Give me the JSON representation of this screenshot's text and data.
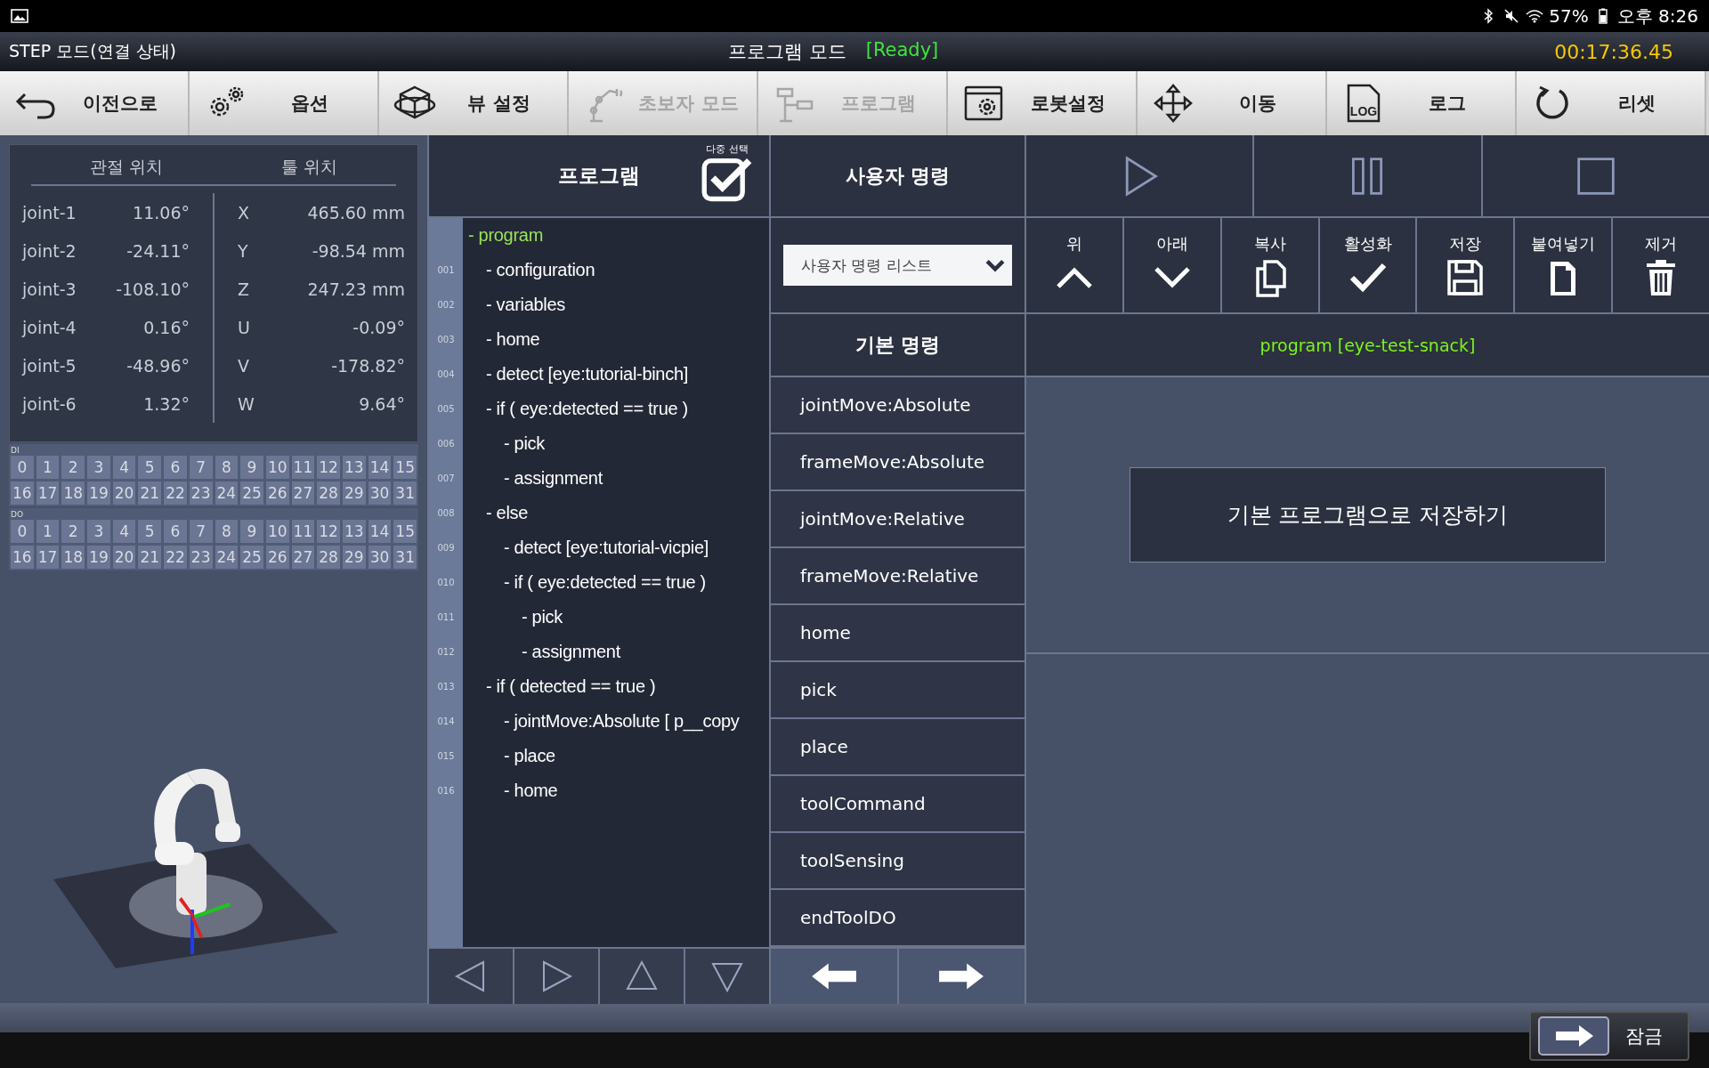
{
  "status_bar": {
    "battery": "57%",
    "time": "오후 8:26"
  },
  "title_bar": {
    "mode": "STEP 모드(연결 상태)",
    "title": "프로그램 모드",
    "state": "[Ready]",
    "timer": "00:17:36.45"
  },
  "toolbar": [
    {
      "label": "이전으로",
      "disabled": false
    },
    {
      "label": "옵션",
      "disabled": false
    },
    {
      "label": "뷰 설정",
      "disabled": false
    },
    {
      "label": "초보자 모드",
      "disabled": true
    },
    {
      "label": "프로그램",
      "disabled": true
    },
    {
      "label": "로봇설정",
      "disabled": false
    },
    {
      "label": "이동",
      "disabled": false
    },
    {
      "label": "로그",
      "disabled": false,
      "icon_text": "LOG"
    },
    {
      "label": "리셋",
      "disabled": false
    }
  ],
  "position": {
    "joint_heading": "관절 위치",
    "tool_heading": "툴 위치",
    "joints": [
      {
        "name": "joint-1",
        "value": "11.06°"
      },
      {
        "name": "joint-2",
        "value": "-24.11°"
      },
      {
        "name": "joint-3",
        "value": "-108.10°"
      },
      {
        "name": "joint-4",
        "value": "0.16°"
      },
      {
        "name": "joint-5",
        "value": "-48.96°"
      },
      {
        "name": "joint-6",
        "value": "1.32°"
      }
    ],
    "tool": [
      {
        "axis": "X",
        "value": "465.60 mm"
      },
      {
        "axis": "Y",
        "value": "-98.54 mm"
      },
      {
        "axis": "Z",
        "value": "247.23 mm"
      },
      {
        "axis": "U",
        "value": "-0.09°"
      },
      {
        "axis": "V",
        "value": "-178.82°"
      },
      {
        "axis": "W",
        "value": "9.64°"
      }
    ]
  },
  "io": [
    {
      "label": "DI",
      "cells": [
        "0",
        "1",
        "2",
        "3",
        "4",
        "5",
        "6",
        "7",
        "8",
        "9",
        "10",
        "11",
        "12",
        "13",
        "14",
        "15",
        "16",
        "17",
        "18",
        "19",
        "20",
        "21",
        "22",
        "23",
        "24",
        "25",
        "26",
        "27",
        "28",
        "29",
        "30",
        "31"
      ]
    },
    {
      "label": "DO",
      "cells": [
        "0",
        "1",
        "2",
        "3",
        "4",
        "5",
        "6",
        "7",
        "8",
        "9",
        "10",
        "11",
        "12",
        "13",
        "14",
        "15",
        "16",
        "17",
        "18",
        "19",
        "20",
        "21",
        "22",
        "23",
        "24",
        "25",
        "26",
        "27",
        "28",
        "29",
        "30",
        "31"
      ]
    }
  ],
  "program": {
    "title": "프로그램",
    "multi_select": {
      "label": "다중 선택",
      "checked": true
    },
    "tree": [
      {
        "label": "- program",
        "selected": true,
        "children": [
          {
            "line": "001",
            "label": "- configuration",
            "selected": false
          },
          {
            "line": "002",
            "label": "- variables",
            "selected": false
          },
          {
            "line": "003",
            "label": "- home",
            "selected": false
          },
          {
            "line": "004",
            "label": "- detect [eye:tutorial-binch]",
            "selected": false
          },
          {
            "line": "005",
            "label": "- if ( eye:detected == true )",
            "selected": false,
            "children": [
              {
                "line": "006",
                "label": "- pick",
                "selected": false
              },
              {
                "line": "007",
                "label": "- assignment",
                "selected": false
              }
            ]
          },
          {
            "line": "008",
            "label": "- else",
            "selected": false,
            "children": [
              {
                "line": "009",
                "label": "- detect [eye:tutorial-vicpie]",
                "selected": false
              },
              {
                "line": "010",
                "label": "- if ( eye:detected == true )",
                "selected": false,
                "children": [
                  {
                    "line": "011",
                    "label": "- pick",
                    "selected": false
                  },
                  {
                    "line": "012",
                    "label": "- assignment",
                    "selected": false
                  }
                ]
              }
            ]
          },
          {
            "line": "013",
            "label": "- if ( detected == true )",
            "selected": false,
            "children": [
              {
                "line": "014",
                "label": "- jointMove:Absolute [ p__copy",
                "selected": false
              },
              {
                "line": "015",
                "label": "- place",
                "selected": false
              },
              {
                "line": "016",
                "label": "- home",
                "selected": false
              }
            ]
          }
        ]
      }
    ]
  },
  "commands": {
    "title": "사용자 명령",
    "dropdown": "사용자 명령 리스트",
    "basic_title": "기본 명령",
    "items": [
      "jointMove:Absolute",
      "frameMove:Absolute",
      "jointMove:Relative",
      "frameMove:Relative",
      "home",
      "pick",
      "place",
      "toolCommand",
      "toolSensing",
      "endToolDO"
    ]
  },
  "edit_buttons": [
    "위",
    "아래",
    "복사",
    "활성화",
    "저장",
    "붙여넣기",
    "제거"
  ],
  "current_program": "program [eye-test-snack]",
  "save_button": "기본 프로그램으로 저장하기",
  "lock_button": "잠금"
}
